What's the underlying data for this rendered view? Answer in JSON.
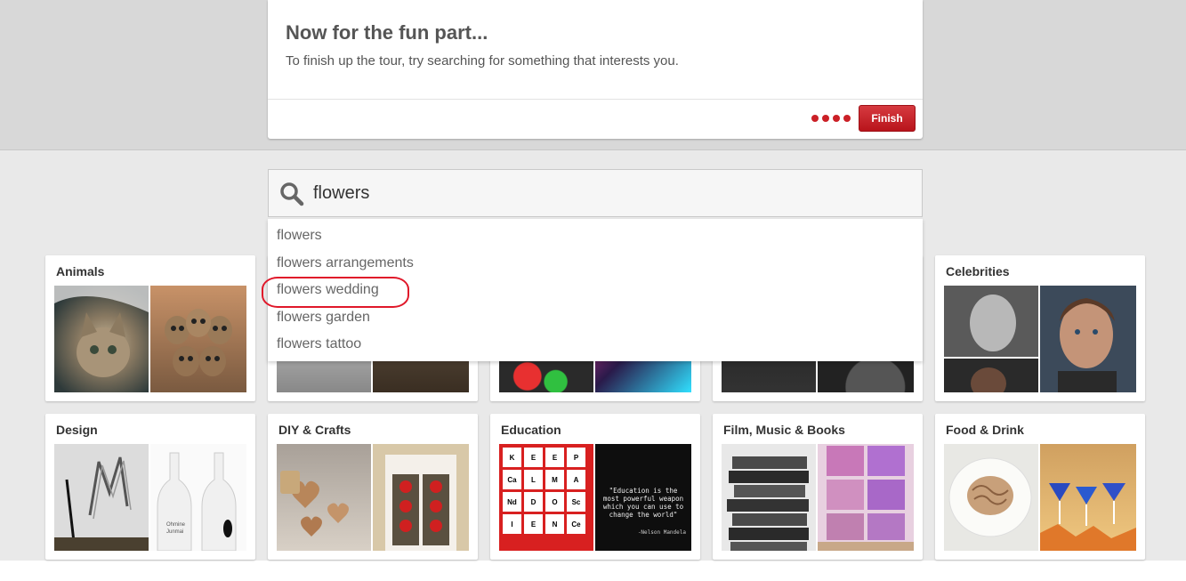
{
  "tour": {
    "title": "Now for the fun part...",
    "text": "To finish up the tour, try searching for something that interests you.",
    "finish_label": "Finish"
  },
  "search": {
    "value": "flowers"
  },
  "suggestions": [
    "flowers",
    "flowers arrangements",
    "flowers wedding",
    "flowers garden",
    "flowers tattoo"
  ],
  "categories": {
    "animals": "Animals",
    "celebrities": "Celebrities",
    "design": "Design",
    "diy": "DIY & Crafts",
    "education": "Education",
    "film": "Film, Music & Books",
    "food": "Food & Drink"
  },
  "education_quote": {
    "text": "\"Education is the most powerful weapon which you can use to change the world\"",
    "author": "-Nelson Mandela"
  },
  "keep_calm_tiles": [
    "K",
    "E",
    "E",
    "P",
    "Ca",
    "L",
    "M",
    "A",
    "Nd",
    "D",
    "O",
    "Sc",
    "I",
    "E",
    "N",
    "Ce"
  ],
  "bottle_text": [
    "Ohmine",
    "Junmai"
  ],
  "colors": {
    "accent_red": "#cb2027",
    "top_band": "#d8d8d8",
    "main_bg": "#e9e9e9"
  }
}
